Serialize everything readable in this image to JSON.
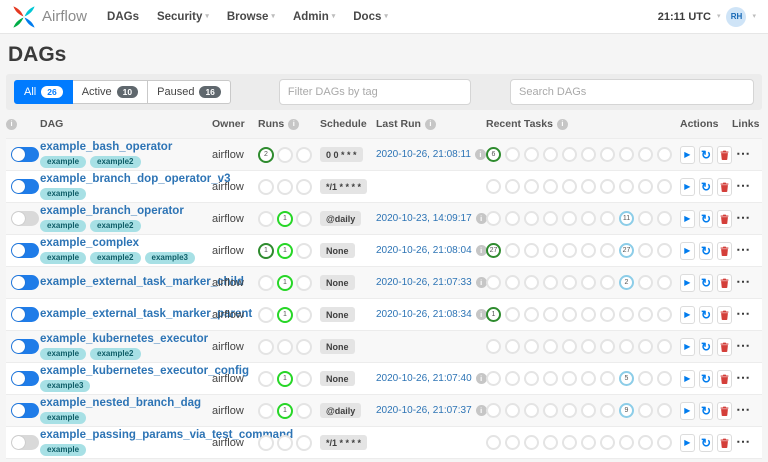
{
  "navbar": {
    "brand": "Airflow",
    "items": [
      {
        "label": "DAGs",
        "dropdown": false
      },
      {
        "label": "Security",
        "dropdown": true
      },
      {
        "label": "Browse",
        "dropdown": true
      },
      {
        "label": "Admin",
        "dropdown": true
      },
      {
        "label": "Docs",
        "dropdown": true
      }
    ],
    "clock": "21:11 UTC",
    "avatar_initials": "RH"
  },
  "page": {
    "title": "DAGs"
  },
  "filters": {
    "tabs": [
      {
        "label": "All",
        "count": "26",
        "active": true
      },
      {
        "label": "Active",
        "count": "10",
        "active": false
      },
      {
        "label": "Paused",
        "count": "16",
        "active": false
      }
    ],
    "tag_filter_placeholder": "Filter DAGs by tag",
    "search_placeholder": "Search DAGs"
  },
  "icons": {
    "info": "i",
    "caret_down": "▾",
    "play": "▶",
    "refresh": "↻",
    "links_ellipsis": "⋯"
  },
  "colors": {
    "primary": "#007bff",
    "link": "#2d74b5",
    "toggle_on": "#1f7ce8",
    "danger": "#d43f3a",
    "states": {
      "success": "#2e8b2e",
      "running": "#27d627",
      "failed": "#e43921",
      "none": "#8ccde8",
      "empty": "#e4e4e4"
    }
  },
  "table": {
    "columns": [
      {
        "key": "toggle",
        "label": "",
        "info": true
      },
      {
        "key": "dag",
        "label": "DAG",
        "info": false
      },
      {
        "key": "owner",
        "label": "Owner",
        "info": false
      },
      {
        "key": "runs",
        "label": "Runs",
        "info": true
      },
      {
        "key": "schedule",
        "label": "Schedule",
        "info": false
      },
      {
        "key": "last_run",
        "label": "Last Run",
        "info": true
      },
      {
        "key": "recent",
        "label": "Recent Tasks",
        "info": true
      },
      {
        "key": "actions",
        "label": "Actions",
        "info": false
      },
      {
        "key": "links",
        "label": "Links",
        "info": false
      }
    ],
    "run_states": [
      "success",
      "running",
      "failed"
    ],
    "recent_states": [
      "success",
      "running",
      "failed",
      "upstream_failed",
      "skipped",
      "up_for_retry",
      "up_for_reschedule",
      "none",
      "queued",
      "scheduled"
    ],
    "row_actions": [
      {
        "icon": "play",
        "name": "trigger-dag-button"
      },
      {
        "icon": "refresh",
        "name": "refresh-dag-button"
      },
      {
        "icon": "trash",
        "name": "delete-dag-button"
      }
    ],
    "rows": [
      {
        "name": "example_bash_operator",
        "tags": [
          "example",
          "example2"
        ],
        "paused": false,
        "owner": "airflow",
        "runs": {
          "success": "2"
        },
        "schedule": "0 0 * * *",
        "last_run": "2020-10-26, 21:08:11",
        "recent": {
          "success": "6"
        }
      },
      {
        "name": "example_branch_dop_operator_v3",
        "tags": [
          "example"
        ],
        "paused": false,
        "owner": "airflow",
        "runs": {},
        "schedule": "*/1 * * * *",
        "last_run": "",
        "recent": {}
      },
      {
        "name": "example_branch_operator",
        "tags": [
          "example",
          "example2"
        ],
        "paused": true,
        "owner": "airflow",
        "runs": {
          "running": "1"
        },
        "schedule": "@daily",
        "last_run": "2020-10-23, 14:09:17",
        "recent": {
          "none": "11"
        }
      },
      {
        "name": "example_complex",
        "tags": [
          "example",
          "example2",
          "example3"
        ],
        "paused": false,
        "owner": "airflow",
        "runs": {
          "success": "1",
          "running": "1"
        },
        "schedule": "None",
        "last_run": "2020-10-26, 21:08:04",
        "recent": {
          "success": "27",
          "none": "27"
        }
      },
      {
        "name": "example_external_task_marker_child",
        "tags": [],
        "paused": false,
        "owner": "airflow",
        "runs": {
          "running": "1"
        },
        "schedule": "None",
        "last_run": "2020-10-26, 21:07:33",
        "recent": {
          "none": "2"
        }
      },
      {
        "name": "example_external_task_marker_parent",
        "tags": [],
        "paused": false,
        "owner": "airflow",
        "runs": {
          "running": "1"
        },
        "schedule": "None",
        "last_run": "2020-10-26, 21:08:34",
        "recent": {
          "success": "1"
        }
      },
      {
        "name": "example_kubernetes_executor",
        "tags": [
          "example",
          "example2"
        ],
        "paused": false,
        "owner": "airflow",
        "runs": {},
        "schedule": "None",
        "last_run": "",
        "recent": {}
      },
      {
        "name": "example_kubernetes_executor_config",
        "tags": [
          "example3"
        ],
        "paused": false,
        "owner": "airflow",
        "runs": {
          "running": "1"
        },
        "schedule": "None",
        "last_run": "2020-10-26, 21:07:40",
        "recent": {
          "none": "5"
        }
      },
      {
        "name": "example_nested_branch_dag",
        "tags": [
          "example"
        ],
        "paused": false,
        "owner": "airflow",
        "runs": {
          "running": "1"
        },
        "schedule": "@daily",
        "last_run": "2020-10-26, 21:07:37",
        "recent": {
          "none": "9"
        }
      },
      {
        "name": "example_passing_params_via_test_command",
        "tags": [
          "example"
        ],
        "paused": true,
        "owner": "airflow",
        "runs": {},
        "schedule": "*/1 * * * *",
        "last_run": "",
        "recent": {}
      }
    ]
  }
}
